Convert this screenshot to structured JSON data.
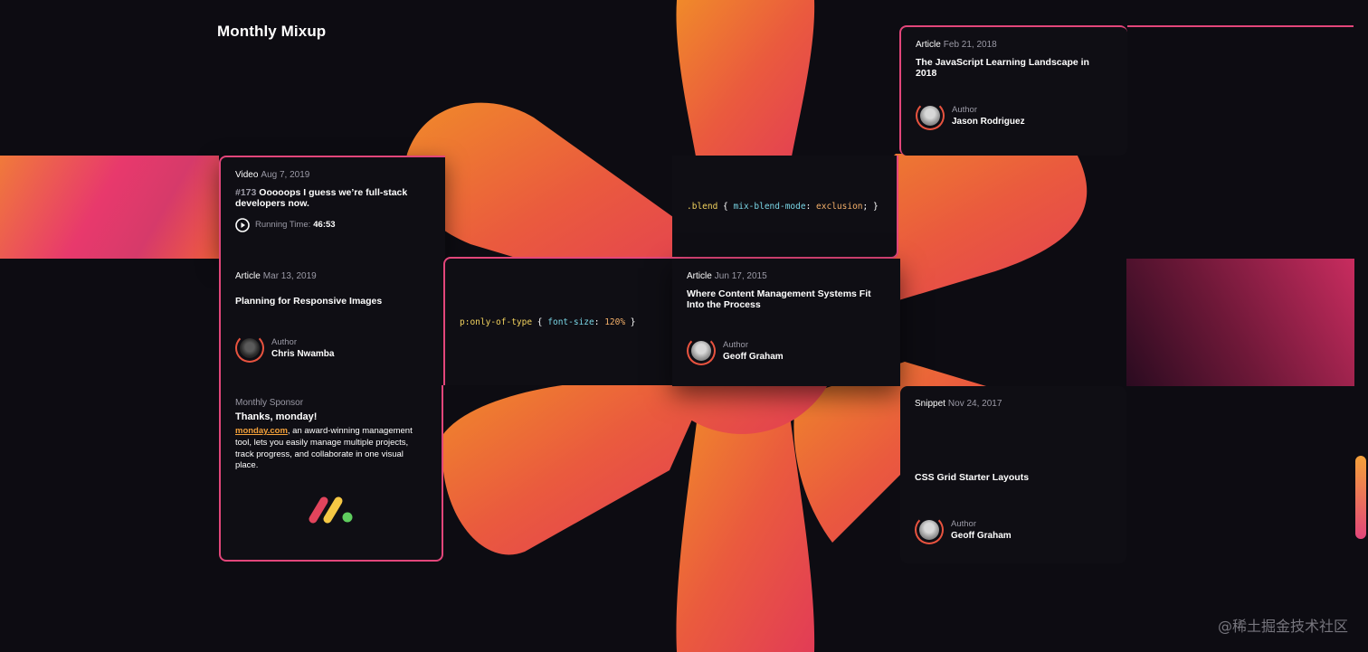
{
  "page": {
    "title": "Monthly Mixup"
  },
  "cards": {
    "video": {
      "type": "Video",
      "date": "Aug 7, 2019",
      "episode": "#173",
      "title": "Ooooops I guess we’re full-stack developers now.",
      "running_label": "Running Time:",
      "running_time": "46:53"
    },
    "article_js": {
      "type": "Article",
      "date": "Feb 21, 2018",
      "title": "The JavaScript Learning Landscape in 2018",
      "author_label": "Author",
      "author_name": "Jason Rodriguez"
    },
    "code_blend": {
      "selector": ".blend",
      "open": " { ",
      "property": "mix-blend-mode",
      "colon": ": ",
      "value": "exclusion",
      "close": "; }"
    },
    "article_responsive": {
      "type": "Article",
      "date": "Mar 13, 2019",
      "title": "Planning for Responsive Images",
      "author_label": "Author",
      "author_name": "Chris Nwamba"
    },
    "code_only": {
      "selector": "p:only-of-type",
      "open": " { ",
      "property": "font-size",
      "colon": ": ",
      "value": "120%",
      "close": " }"
    },
    "article_cms": {
      "type": "Article",
      "date": "Jun 17, 2015",
      "title": "Where Content Management Systems Fit Into the Process",
      "author_label": "Author",
      "author_name": "Geoff Graham"
    },
    "sponsor": {
      "label": "Monthly Sponsor",
      "title": "Thanks, monday!",
      "link": "monday.com",
      "text": ", an award-winning management tool, lets you easily manage multiple projects, track progress, and collaborate in one visual place."
    },
    "snippet": {
      "type": "Snippet",
      "date": "Nov 24, 2017",
      "title": "CSS Grid Starter Layouts",
      "author_label": "Author",
      "author_name": "Geoff Graham"
    }
  },
  "colors": {
    "accent_pink": "#e2467a",
    "accent_orange": "#f07a3a",
    "background": "#0d0c12"
  },
  "watermark": "@稀土掘金技术社区"
}
